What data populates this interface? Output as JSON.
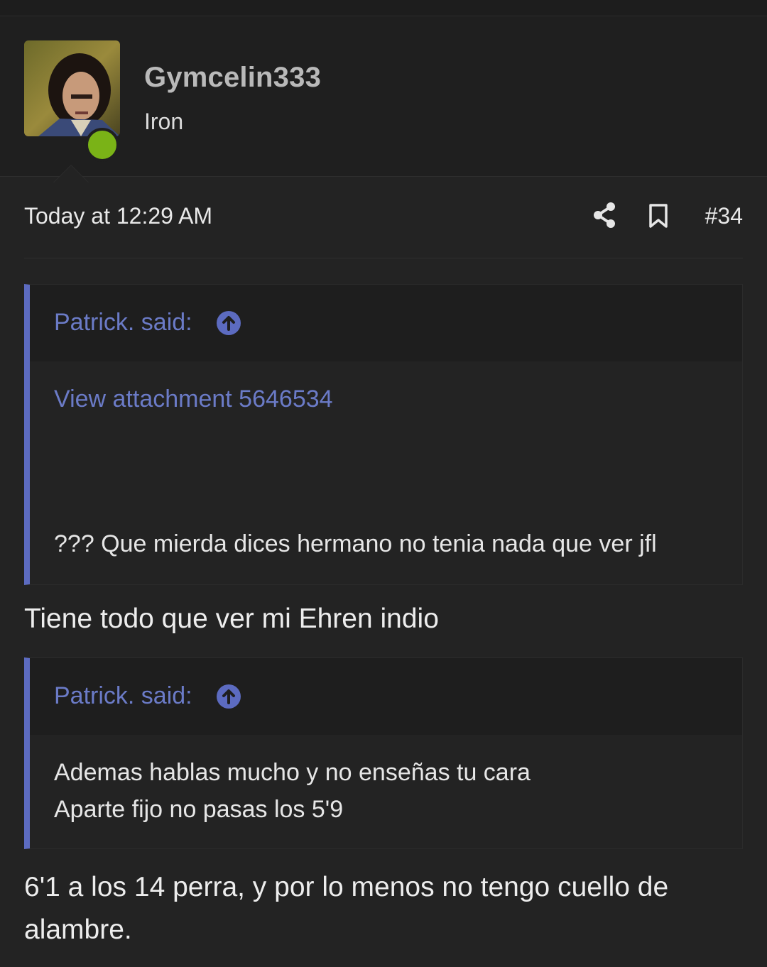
{
  "user": {
    "name": "Gymcelin333",
    "title": "Iron",
    "status": "online"
  },
  "post": {
    "date": "Today at 12:29 AM",
    "number": "#34"
  },
  "quotes": [
    {
      "author": "Patrick. said:",
      "attachment": "View attachment 5646534",
      "text": "??? Que mierda dices hermano no tenia nada que ver jfl"
    },
    {
      "author": "Patrick. said:",
      "lines": [
        "Ademas hablas mucho y no enseñas tu cara",
        "Aparte fijo no pasas los 5'9"
      ]
    }
  ],
  "replies": [
    "Tiene todo que ver mi Ehren indio",
    "6'1 a los 14 perra, y por lo menos no tengo cuello de alambre."
  ],
  "icons": {
    "share": "share-icon",
    "bookmark": "bookmark-icon",
    "quote_jump": "arrow-up-circle-icon"
  },
  "colors": {
    "accent": "#5c6bc0",
    "link": "#6b7bc7",
    "online": "#7ab317",
    "background": "#232323"
  }
}
